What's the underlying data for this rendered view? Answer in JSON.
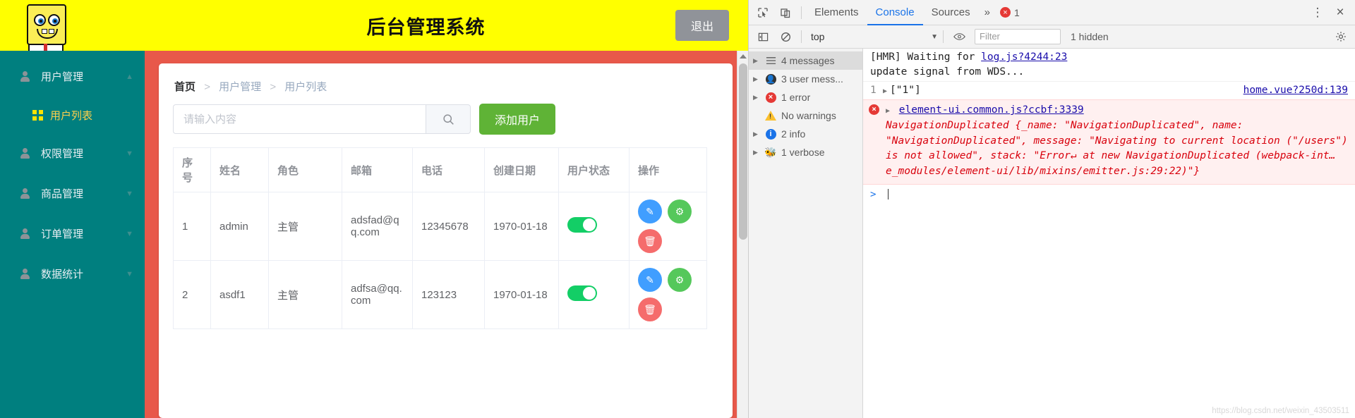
{
  "app": {
    "header": {
      "title": "后台管理系统",
      "logout_label": "退出",
      "logo_icon": "spongebob-logo"
    },
    "sidebar": {
      "items": [
        {
          "label": "用户管理",
          "icon": "person-icon",
          "chevron": "chevron-up-icon"
        },
        {
          "label": "权限管理",
          "icon": "person-icon",
          "chevron": "chevron-down-icon"
        },
        {
          "label": "商品管理",
          "icon": "person-icon",
          "chevron": "chevron-down-icon"
        },
        {
          "label": "订单管理",
          "icon": "person-icon",
          "chevron": "chevron-down-icon"
        },
        {
          "label": "数据统计",
          "icon": "person-icon",
          "chevron": "chevron-down-icon"
        }
      ],
      "sub_item": {
        "label": "用户列表",
        "icon": "grid-icon"
      }
    },
    "breadcrumb": {
      "items": [
        "首页",
        "用户管理",
        "用户列表"
      ],
      "separator": ">"
    },
    "toolbar": {
      "search_value": "",
      "search_placeholder": "请输入内容",
      "search_icon": "search-icon",
      "add_label": "添加用户"
    },
    "table": {
      "headers": [
        "序号",
        "姓名",
        "角色",
        "邮箱",
        "电话",
        "创建日期",
        "用户状态",
        "操作"
      ],
      "rows": [
        {
          "index": "1",
          "name": "admin",
          "role": "主管",
          "email": "adsfad@qq.com",
          "phone": "12345678",
          "date": "1970-01-18",
          "status_on": true,
          "actions": [
            "edit-icon",
            "settings-icon",
            "delete-icon"
          ]
        },
        {
          "index": "2",
          "name": "asdf1",
          "role": "主管",
          "email": "adfsa@qq.com",
          "phone": "123123",
          "date": "1970-01-18",
          "status_on": true,
          "actions": [
            "edit-icon",
            "settings-icon",
            "delete-icon"
          ]
        }
      ]
    },
    "colors": {
      "header_bg": "#ffff00",
      "sidebar_bg": "#007f7f",
      "content_bg": "#e8584a",
      "accent_green": "#5fb336"
    }
  },
  "devtools": {
    "tabs": [
      {
        "label": "Elements",
        "active": false
      },
      {
        "label": "Console",
        "active": true
      },
      {
        "label": "Sources",
        "active": false
      }
    ],
    "more_icon": "chevron-double-right-icon",
    "error_count": "1",
    "kebab_icon": "more-vertical-icon",
    "close_icon": "close-icon",
    "inspect_icon": "inspect-element-icon",
    "device_icon": "device-toolbar-icon",
    "filter_toolbar": {
      "sidebar_toggle_icon": "console-sidebar-icon",
      "clear_icon": "clear-console-icon",
      "context": "top",
      "eye_icon": "live-expression-icon",
      "filter_placeholder": "Filter",
      "hidden_label": "1 hidden",
      "settings_icon": "gear-icon"
    },
    "sidebar": [
      {
        "label": "4 messages",
        "icon": "list-icon",
        "selected": true,
        "expandable": true
      },
      {
        "label": "3 user mess...",
        "icon": "user-icon",
        "selected": false,
        "expandable": true
      },
      {
        "label": "1 error",
        "icon": "error-icon",
        "selected": false,
        "expandable": true
      },
      {
        "label": "No warnings",
        "icon": "warning-icon",
        "selected": false,
        "expandable": false
      },
      {
        "label": "2 info",
        "icon": "info-icon",
        "selected": false,
        "expandable": true
      },
      {
        "label": "1 verbose",
        "icon": "verbose-icon",
        "selected": false,
        "expandable": true
      }
    ],
    "console": {
      "hmr_text": "[HMR] Waiting for",
      "hmr_link": "log.js?4244:23",
      "hmr_text2": "update signal from WDS...",
      "obj_line_num": "1",
      "obj_value": "[\"1\"]",
      "obj_link": "home.vue?250d:139",
      "error_link": "element-ui.common.js?ccbf:3339",
      "error_body": "NavigationDuplicated {_name: \"NavigationDuplicated\", name: \"NavigationDuplicated\", message: \"Navigating to current location (\"/users\") is not allowed\", stack: \"Error↵    at new NavigationDuplicated (webpack-int…e_modules/element-ui/lib/mixins/emitter.js:29:22)\"}",
      "prompt_symbol": ">"
    },
    "watermark": "https://blog.csdn.net/weixin_43503511"
  }
}
